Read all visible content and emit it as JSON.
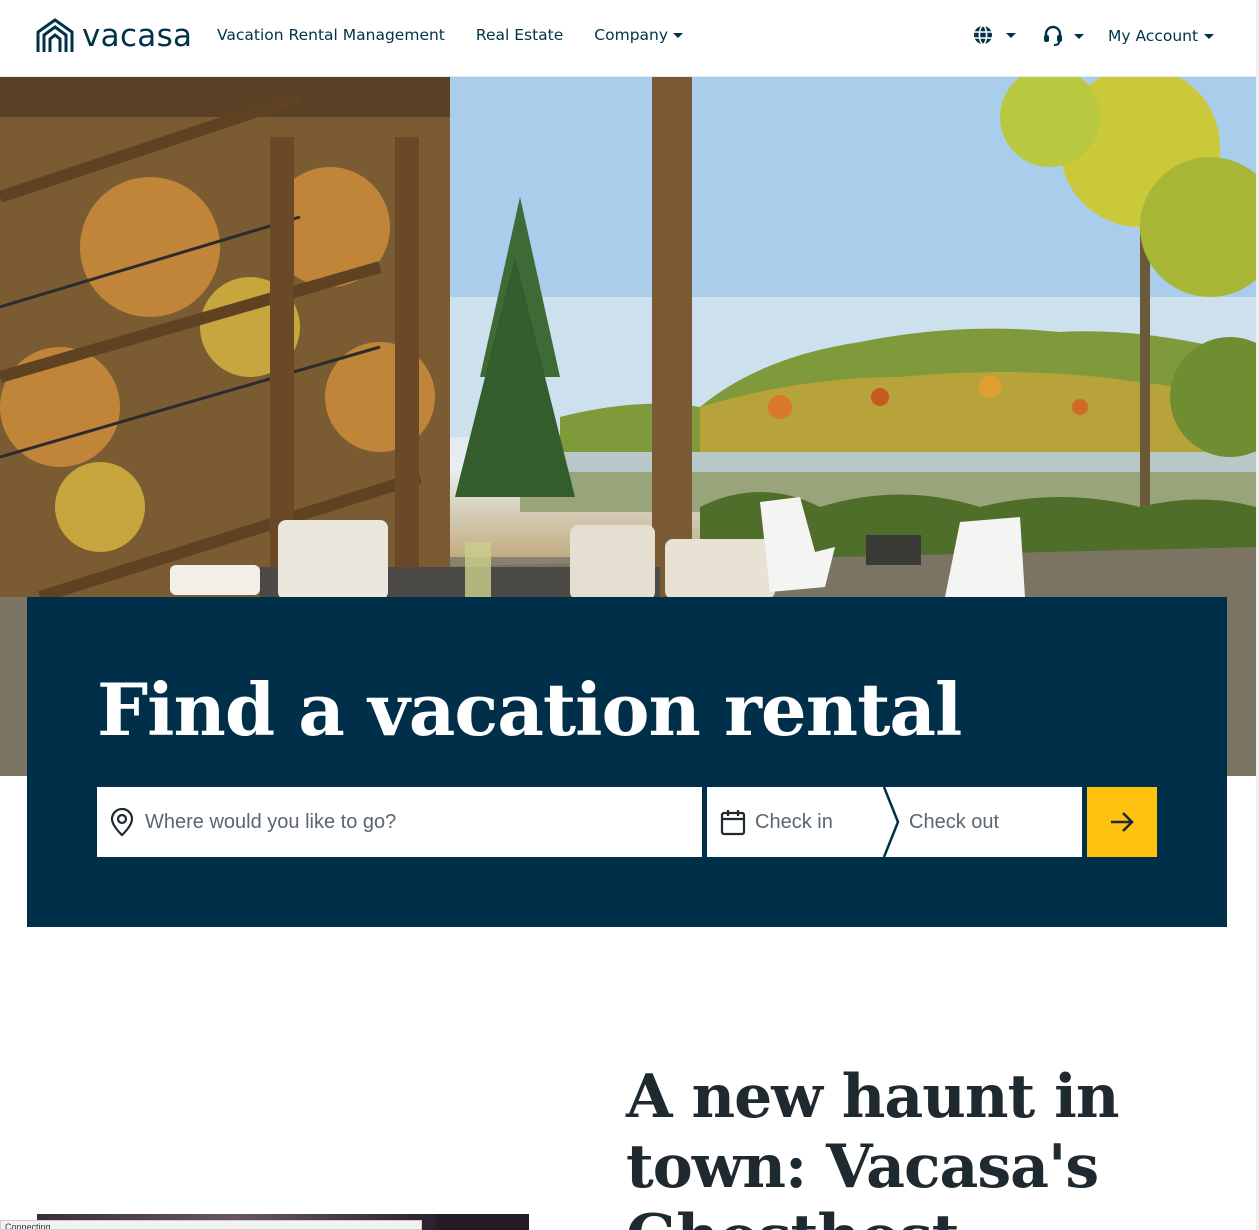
{
  "brand": {
    "name": "vacasa",
    "color": "#003349"
  },
  "nav": {
    "items": [
      {
        "label": "Vacation Rental Management",
        "dropdown": false
      },
      {
        "label": "Real Estate",
        "dropdown": false
      },
      {
        "label": "Company",
        "dropdown": true
      }
    ]
  },
  "utility": {
    "language_icon": "globe-icon",
    "support_icon": "headset-icon",
    "account_label": "My Account"
  },
  "hero": {
    "image_alt": "Lakeside deck with outdoor dining set, stairs and autumn trees",
    "title": "Find a vacation rental"
  },
  "search": {
    "where_placeholder": "Where would you like to go?",
    "checkin_label": "Check in",
    "checkout_label": "Check out",
    "submit_icon": "arrow-right-icon",
    "accent_color": "#ffc20e",
    "panel_color": "#003049"
  },
  "promo": {
    "title": "A new haunt in town: Vacasa's Ghosthost"
  },
  "status_bar": {
    "text": "Connecting..."
  }
}
